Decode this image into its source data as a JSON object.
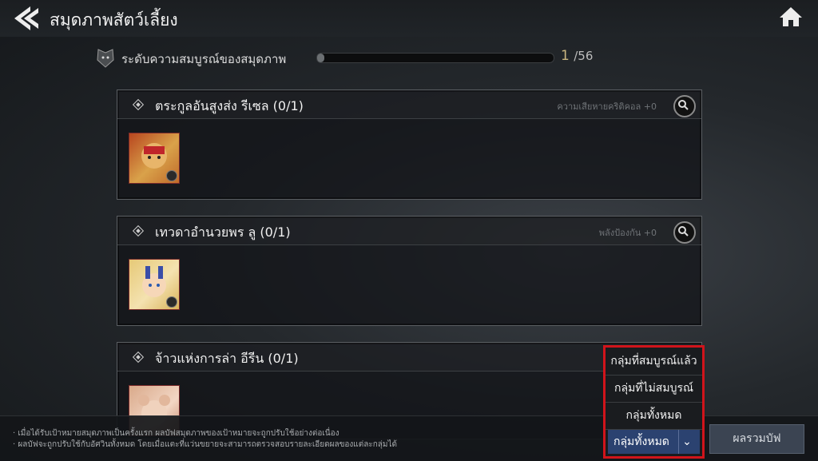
{
  "header": {
    "title": "สมุดภาพสัตว์เลี้ยง"
  },
  "progress": {
    "label": "ระดับความสมบูรณ์ของสมุดภาพ",
    "current": "1",
    "total": "/56",
    "fraction": 0.018
  },
  "cards": [
    {
      "title": "ตระกูลอันสูงส่ง รีเซล (0/1)",
      "bonus": "ความเสียหายคริติคอล +0"
    },
    {
      "title": "เทวดาอำนวยพร ลู (0/1)",
      "bonus": "พลังป้องกัน +0"
    },
    {
      "title": "จ้าวแห่งการล่า อีรีน (0/1)",
      "bonus": ""
    }
  ],
  "footer": {
    "notes": [
      "· เมื่อได้รับเป้าหมายสมุดภาพเป็นครั้งแรก ผลบัฟสมุดภาพของเป้าหมายจะถูกปรับใช้อย่างต่อเนื่อง",
      "· ผลบัฟจะถูกปรับใช้กับอัศวินทั้งหมด โดยเมื่อแตะที่แว่นขยายจะสามารถตรวจสอบรายละเอียดผลของแต่ละกลุ่มได้"
    ],
    "summary_button": "ผลรวมบัฟ"
  },
  "filter_dropdown": {
    "options": [
      "กลุ่มที่สมบูรณ์แล้ว",
      "กลุ่มที่ไม่สมบูรณ์",
      "กลุ่มทั้งหมด"
    ],
    "selected": "กลุ่มทั้งหมด"
  },
  "colors": {
    "highlight": "#d1141b",
    "selected_bg": "#2b4270",
    "progress_current": "#c8b580"
  }
}
